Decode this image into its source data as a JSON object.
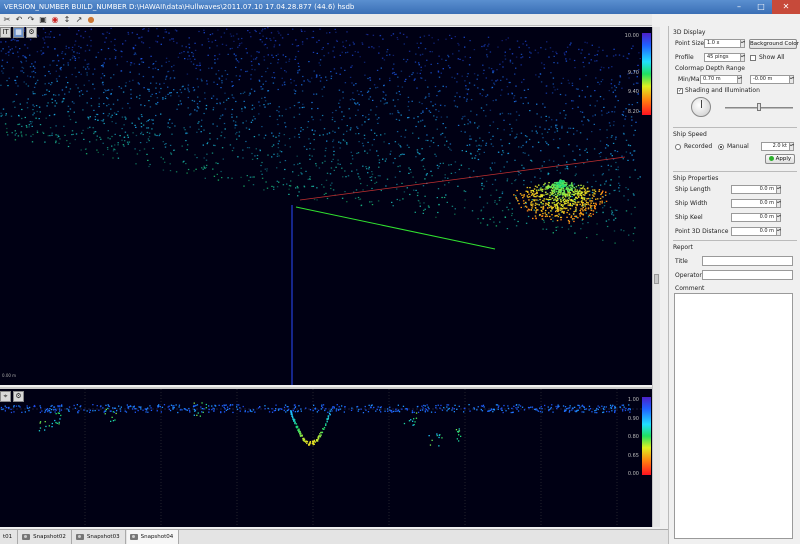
{
  "window": {
    "title": "VERSION_NUMBER BUILD_NUMBER    D:\\HAWAII\\data\\Hullwaves\\2011.07.10 17.04.28.877 (44.6) hsdb",
    "min": "–",
    "max": "□",
    "close": "✕"
  },
  "toolbar": {
    "icons": [
      "cut-icon",
      "undo-icon",
      "camera-icon",
      "record-icon",
      "measure-icon",
      "color-icon"
    ]
  },
  "view3d": {
    "tools": [
      "IT",
      "▦",
      "⚙"
    ],
    "colorbar": {
      "ticks": [
        "10.00",
        "9.70",
        "9.40",
        "8.20"
      ]
    },
    "corner_label": "0.00 m",
    "dots_seed": 42
  },
  "view2d": {
    "tools": [
      "⌖",
      "⚙"
    ],
    "colorbar": {
      "ticks": [
        "1.00",
        "0.90",
        "0.80",
        "0.65",
        "0.00"
      ]
    }
  },
  "panel": {
    "display": {
      "title": "3D Display",
      "point_size_label": "Point Size",
      "point_size_value": "1.0 x",
      "background_color_button": "Background Color",
      "profile_label": "Profile",
      "profile_value": "45 pings",
      "show_all_label": "Show All",
      "colormap_label": "Colormap Depth Range",
      "minmax_label": "Min/Max",
      "min_value": "0.70 m",
      "max_value": "-0.00 m",
      "shading_label": "Shading and Illumination",
      "shading_checked": "✓"
    },
    "speed": {
      "title": "Ship Speed",
      "recorded_label": "Recorded",
      "manual_label": "Manual",
      "speed_value": "2.0 kt",
      "apply_button": "Apply"
    },
    "props": {
      "title": "Ship Properties",
      "length_label": "Ship Length",
      "length_value": "0.0 m",
      "width_label": "Ship Width",
      "width_value": "0.0 m",
      "keel_label": "Ship Keel",
      "keel_value": "0.0 m",
      "point_distance_label": "Point 3D Distance",
      "point_distance_value": "0.0 m"
    },
    "report": {
      "title": "Report",
      "title_label": "Title",
      "operator_label": "Operator",
      "comment_label": "Comment"
    }
  },
  "status": {
    "tabs": [
      "t01",
      "Snapshot02",
      "Snapshot03",
      "Snapshot04"
    ]
  }
}
